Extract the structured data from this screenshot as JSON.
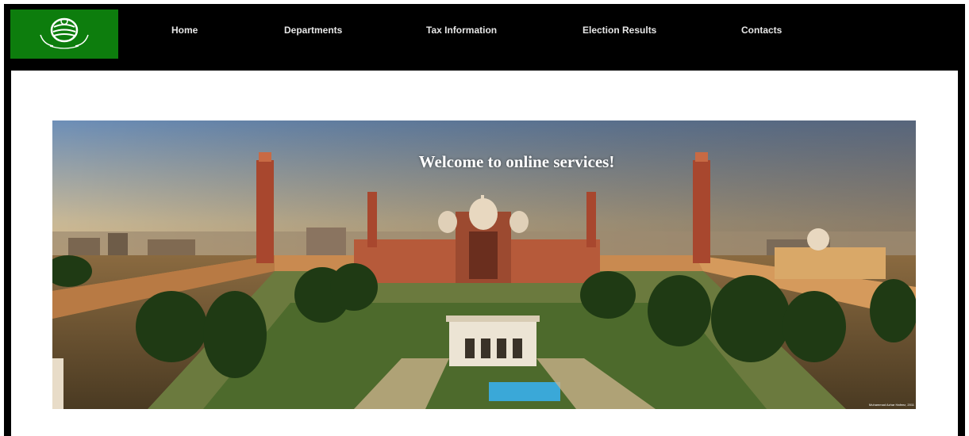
{
  "header": {
    "logo_icon": "punjab-emblem-icon",
    "logo_bg": "#0d7d0d",
    "nav": [
      {
        "label": "Home"
      },
      {
        "label": "Departments"
      },
      {
        "label": "Tax Information"
      },
      {
        "label": "Election Results"
      },
      {
        "label": "Contacts"
      }
    ]
  },
  "hero": {
    "heading": "Welcome to online services!",
    "photo_credit": "Muhammad Azhar Hafeez, 2011"
  }
}
